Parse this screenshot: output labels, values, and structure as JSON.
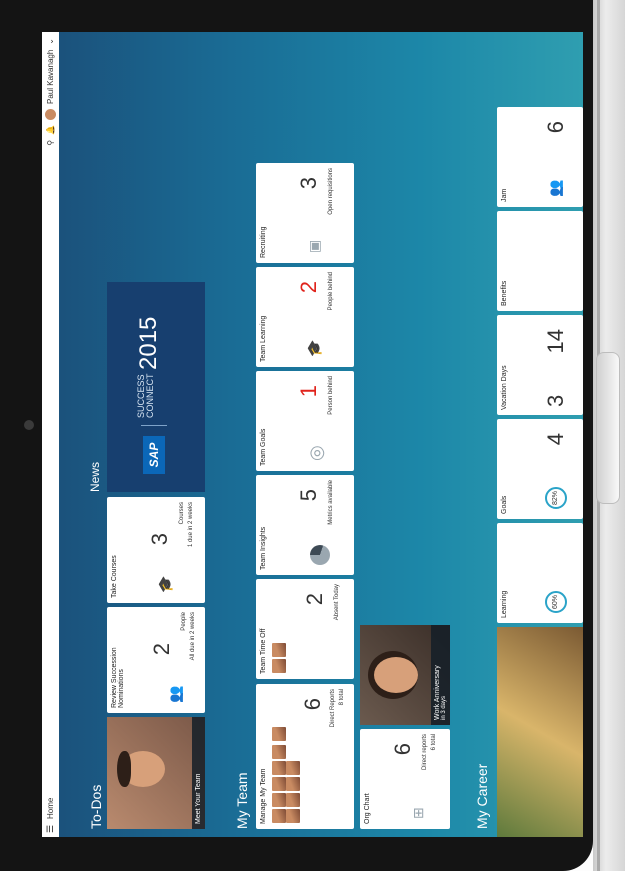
{
  "shell": {
    "home_label": "Home",
    "user_name": "Paul Kavanagh",
    "menu_icon": "hamburger-icon",
    "search_icon": "search-icon",
    "bell_icon": "bell-icon"
  },
  "sections": {
    "todos": "To-Dos",
    "news": "News",
    "my_team": "My Team",
    "my_career": "My Career"
  },
  "todos": [
    {
      "type": "photo",
      "label": "Meet Your Team"
    },
    {
      "title": "Review Succession Nominations",
      "value": "2",
      "unit": "People",
      "sub": "All due in 2 weeks",
      "icon": "people-icon"
    },
    {
      "title": "Take Courses",
      "value": "3",
      "unit": "Courses",
      "sub": "1 due in 2 weeks",
      "icon": "graduation-cap-icon"
    }
  ],
  "news": {
    "brand": "SAP",
    "event": "SUCCESS CONNECT",
    "year": "2015"
  },
  "my_team": {
    "manage": {
      "title": "Manage My Team",
      "value": "6",
      "unit": "Direct Reports",
      "sub": "8 total"
    },
    "time_off": {
      "title": "Team Time Off",
      "value": "2",
      "unit": "Absent Today"
    },
    "insights": {
      "title": "Team Insights",
      "value": "5",
      "unit": "Metrics available",
      "icon": "pie-chart-icon"
    },
    "goals": {
      "title": "Team Goals",
      "value": "1",
      "unit": "Person behind",
      "icon": "target-icon"
    },
    "learning": {
      "title": "Team Learning",
      "value": "2",
      "unit": "People behind",
      "icon": "graduation-cap-icon"
    },
    "recruiting": {
      "title": "Recruiting",
      "value": "3",
      "unit": "Open requisitions",
      "icon": "recruiting-icon"
    },
    "org_chart": {
      "title": "Org Chart",
      "value": "6",
      "unit": "Direct reports",
      "sub": "6 total",
      "icon": "org-chart-icon"
    },
    "anniversary": {
      "label": "Work Anniversary",
      "sub": "in 3 days"
    }
  },
  "my_career": {
    "learning": {
      "title": "Learning",
      "gauge": "60%"
    },
    "goals": {
      "title": "Goals",
      "value": "4",
      "gauge": "82%"
    },
    "vacation": {
      "title": "Vacation Days",
      "value": "3",
      "value2": "14"
    },
    "benefits": {
      "title": "Benefits"
    },
    "jam": {
      "title": "Jam",
      "value": "6"
    }
  }
}
